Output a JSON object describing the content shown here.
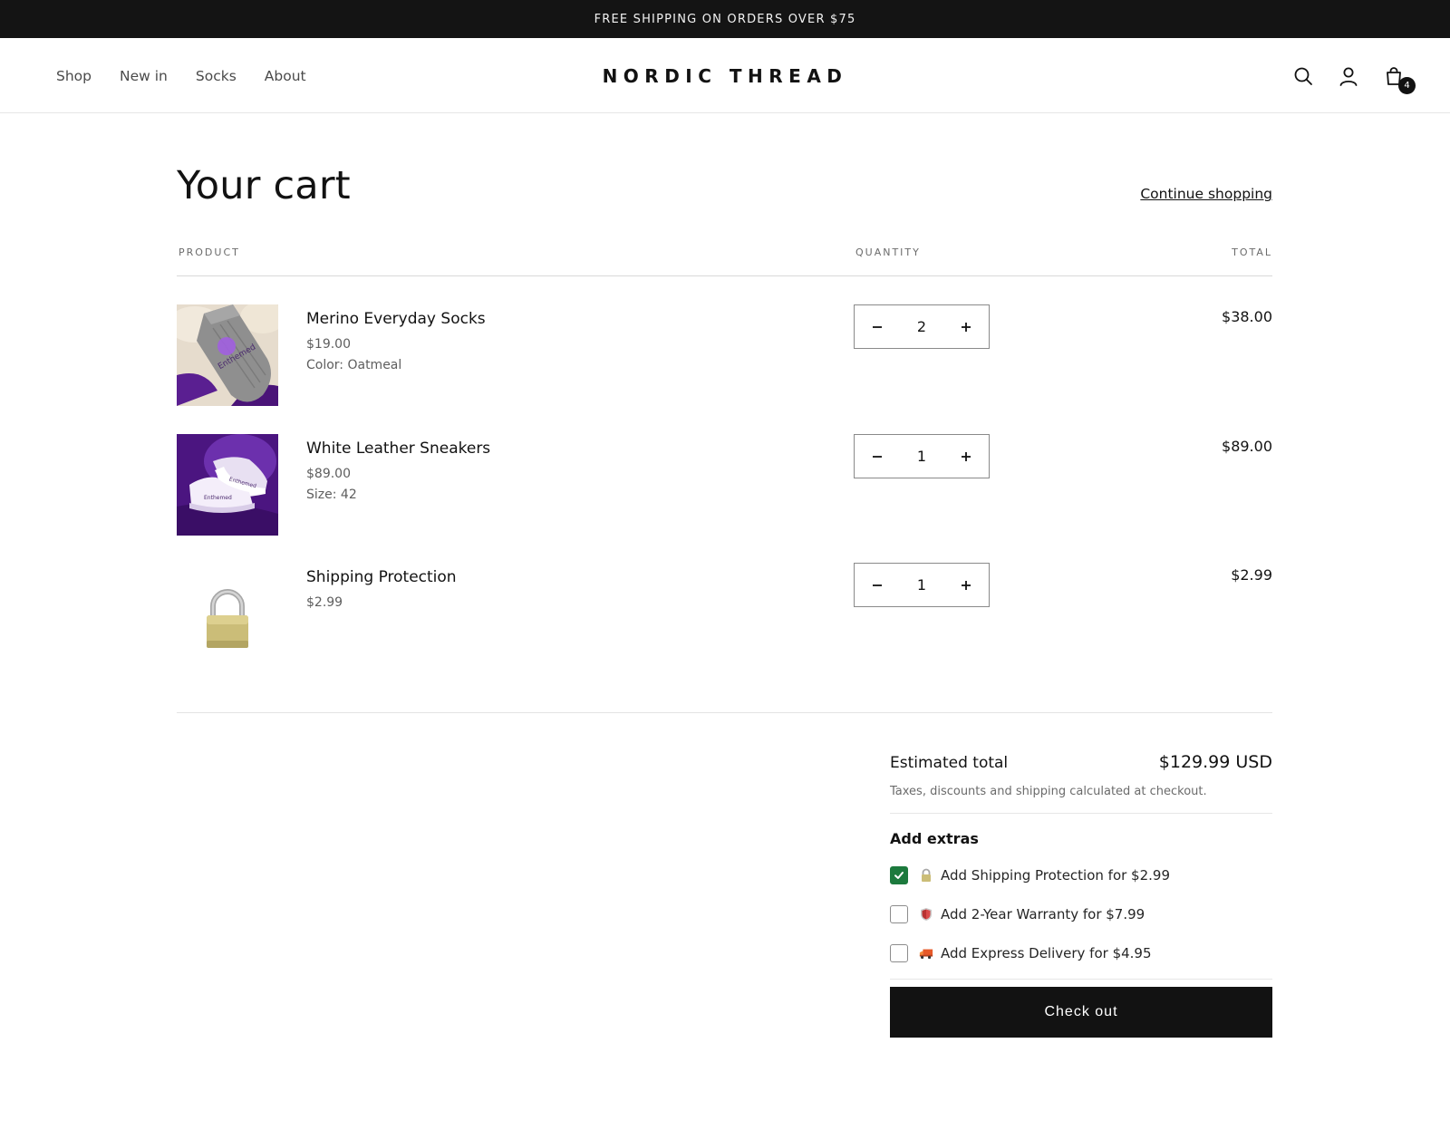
{
  "announcement": "FREE SHIPPING ON ORDERS OVER $75",
  "nav": {
    "items": [
      "Shop",
      "New in",
      "Socks",
      "About"
    ]
  },
  "brand": "NORDIC THREAD",
  "header_icons": {
    "search": "search-icon",
    "account": "account-icon",
    "cart": "cart-icon",
    "cart_count": "4"
  },
  "cart": {
    "title": "Your cart",
    "continue_label": "Continue shopping",
    "columns": {
      "product": "PRODUCT",
      "quantity": "QUANTITY",
      "total": "TOTAL"
    },
    "items": [
      {
        "name": "Merino Everyday Socks",
        "price": "$19.00",
        "option": "Color: Oatmeal",
        "quantity": "2",
        "total": "$38.00"
      },
      {
        "name": "White Leather Sneakers",
        "price": "$89.00",
        "option": "Size: 42",
        "quantity": "1",
        "total": "$89.00"
      },
      {
        "name": "Shipping Protection",
        "price": "$2.99",
        "quantity": "1",
        "total": "$2.99"
      }
    ]
  },
  "summary": {
    "estimated_label": "Estimated total",
    "estimated_value": "$129.99 USD",
    "tax_note": "Taxes, discounts and shipping calculated at checkout.",
    "extras_title": "Add extras",
    "extras": [
      {
        "label": "Add Shipping Protection for $2.99",
        "checked": true,
        "icon": "padlock-icon"
      },
      {
        "label": "Add 2-Year Warranty for $7.99",
        "checked": false,
        "icon": "shield-icon"
      },
      {
        "label": "Add Express Delivery for $4.95",
        "checked": false,
        "icon": "truck-icon"
      }
    ],
    "checkout_label": "Check out"
  },
  "colors": {
    "accent_dark": "#121212",
    "checkbox_checked": "#1c7a3d",
    "thumb_purple": "#5a1f91"
  }
}
